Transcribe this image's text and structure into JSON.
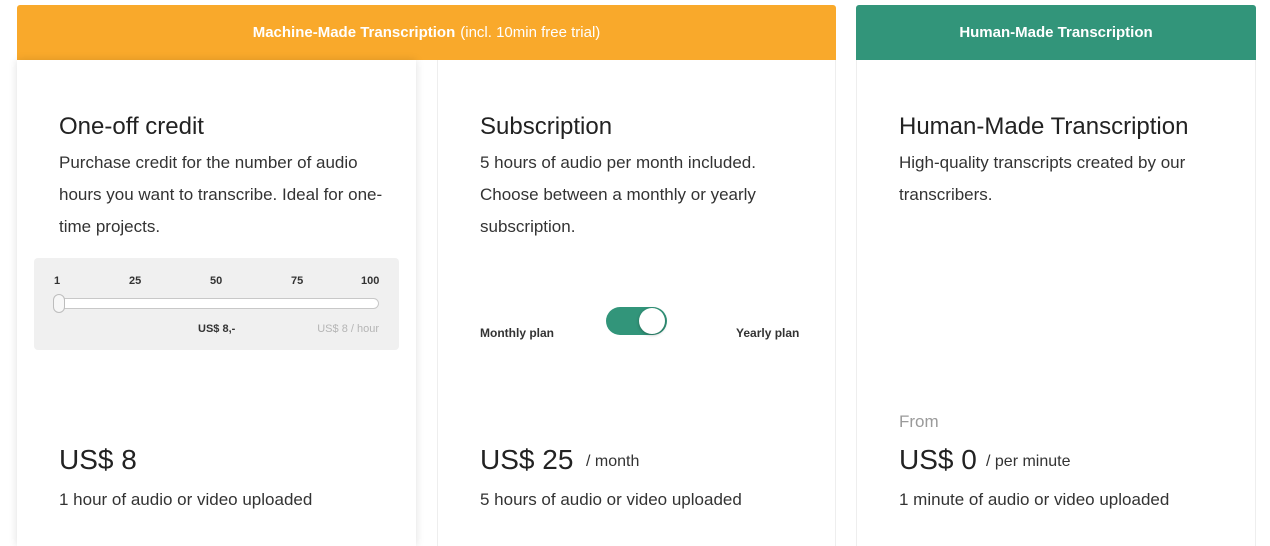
{
  "headers": {
    "machine": {
      "title": "Machine-Made Transcription",
      "note": "(incl. 10min free trial)"
    },
    "human": {
      "title": "Human-Made Transcription"
    }
  },
  "oneoff": {
    "title": "One-off credit",
    "desc": "Purchase credit for the number of audio hours you want to transcribe. Ideal for one-time projects.",
    "slider": {
      "ticks": [
        "1",
        "25",
        "50",
        "75",
        "100"
      ],
      "value_hours": 1,
      "price": "US$ 8,-",
      "rate": "US$ 8 / hour"
    },
    "price": "US$ 8",
    "note": "1 hour of audio or video uploaded"
  },
  "subscription": {
    "title": "Subscription",
    "desc": "5 hours of audio per month included. Choose between a monthly or yearly subscription.",
    "monthly_label": "Monthly plan",
    "yearly_label": "Yearly plan",
    "toggle_state": "yearly",
    "price": "US$ 25",
    "unit": "/ month",
    "note": "5 hours of audio or video uploaded"
  },
  "human": {
    "title": "Human-Made Transcription",
    "desc": "High-quality transcripts created by our transcribers.",
    "from": "From",
    "price": "US$ 0",
    "unit": "/ per minute",
    "note": "1 minute of audio or video uploaded"
  },
  "colors": {
    "machine_header": "#f9a92b",
    "human_header": "#32957a",
    "toggle": "#32957a"
  }
}
